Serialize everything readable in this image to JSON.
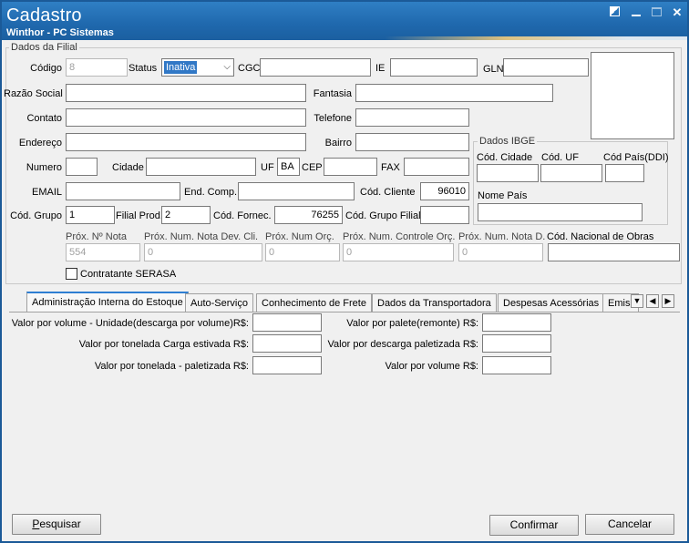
{
  "window": {
    "title": "Cadastro",
    "subtitle": "Winthor - PC Sistemas"
  },
  "filial_group": {
    "title": "Dados da Filial",
    "codigo": {
      "label": "Código",
      "value": "8"
    },
    "status": {
      "label": "Status",
      "value": "Inativa"
    },
    "cgc": {
      "label": "CGC",
      "value": ""
    },
    "ie": {
      "label": "IE",
      "value": ""
    },
    "gln": {
      "label": "GLN",
      "value": ""
    },
    "razao_social": {
      "label": "Razão Social",
      "value": ""
    },
    "fantasia": {
      "label": "Fantasia",
      "value": ""
    },
    "contato": {
      "label": "Contato",
      "value": ""
    },
    "telefone": {
      "label": "Telefone",
      "value": ""
    },
    "endereco": {
      "label": "Endereço",
      "value": ""
    },
    "bairro": {
      "label": "Bairro",
      "value": ""
    },
    "numero": {
      "label": "Numero",
      "value": ""
    },
    "cidade": {
      "label": "Cidade",
      "value": ""
    },
    "uf": {
      "label": "UF",
      "value": "BA"
    },
    "cep": {
      "label": "CEP",
      "value": ""
    },
    "fax": {
      "label": "FAX",
      "value": ""
    },
    "email": {
      "label": "EMAIL",
      "value": ""
    },
    "end_comp": {
      "label": "End. Comp.",
      "value": ""
    },
    "cod_cliente": {
      "label": "Cód. Cliente",
      "value": "96010"
    },
    "cod_grupo": {
      "label": "Cód. Grupo",
      "value": "1"
    },
    "filial_prod": {
      "label": "Filial Prod.",
      "value": "2"
    },
    "cod_fornec": {
      "label": "Cód. Fornec.",
      "value": "76255"
    },
    "cod_grupo_filial": {
      "label": "Cód. Grupo Filial",
      "value": ""
    },
    "prox_nota": {
      "label": "Próx. Nº Nota",
      "value": "554"
    },
    "prox_nota_dev": {
      "label": "Próx. Num. Nota Dev. Cli.",
      "value": "0"
    },
    "prox_orc": {
      "label": "Próx. Num Orç.",
      "value": "0"
    },
    "prox_controle": {
      "label": "Próx. Num. Controle Orç.",
      "value": "0"
    },
    "prox_nota_d": {
      "label": "Próx. Num. Nota D.",
      "value": "0"
    },
    "cod_nacional_obras": {
      "label": "Cód. Nacional de Obras",
      "value": ""
    },
    "contratante_serasa": {
      "label": "Contratante SERASA",
      "checked": false
    }
  },
  "ibge_group": {
    "title": "Dados IBGE",
    "cod_cidade": {
      "label": "Cód. Cidade",
      "value": ""
    },
    "cod_uf": {
      "label": "Cód. UF",
      "value": ""
    },
    "cod_pais": {
      "label": "Cód País(DDI)",
      "value": ""
    },
    "nome_pais": {
      "label": "Nome País",
      "value": ""
    }
  },
  "tabs": [
    {
      "label": "Administração Interna do Estoque",
      "active": true
    },
    {
      "label": "Auto-Serviço"
    },
    {
      "label": "Conhecimento de Frete"
    },
    {
      "label": "Dados da Transportadora"
    },
    {
      "label": "Despesas Acessórias"
    },
    {
      "label": "Emiss"
    }
  ],
  "estoque": {
    "valor_volume_unidade": {
      "label": "Valor por volume - Unidade(descarga por volume)R$:",
      "value": ""
    },
    "valor_tonelada_carga": {
      "label": "Valor por tonelada Carga estivada R$:",
      "value": ""
    },
    "valor_tonelada_paletizada": {
      "label": "Valor por tonelada - paletizada R$:",
      "value": ""
    },
    "valor_palete": {
      "label": "Valor por palete(remonte) R$:",
      "value": ""
    },
    "valor_descarga_paletizada": {
      "label": "Valor por descarga paletizada R$:",
      "value": ""
    },
    "valor_volume": {
      "label": "Valor por volume R$:",
      "value": ""
    }
  },
  "buttons": {
    "pesquisar_first": "P",
    "pesquisar_rest": "esquisar",
    "confirmar": "Confirmar",
    "cancelar": "Cancelar"
  },
  "colors": {
    "title_bar": "#1f68ad",
    "active_tab_accent": "#2e7fd2",
    "selection": "#3178c6"
  }
}
